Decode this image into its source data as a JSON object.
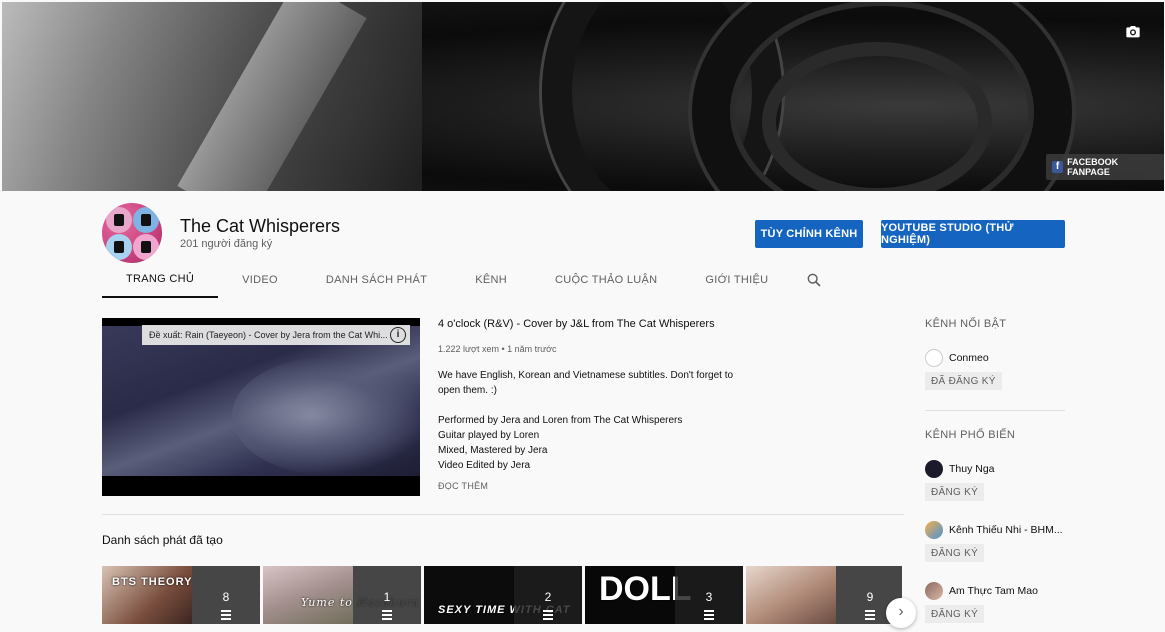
{
  "banner": {
    "facebook_link": "FACEBOOK FANPAGE",
    "camera_icon": "camera-icon"
  },
  "channel": {
    "name": "The Cat Whisperers",
    "subscribers": "201 người đăng ký",
    "customize_button": "TÙY CHỈNH KÊNH",
    "studio_button": "YOUTUBE STUDIO (THỬ NGHIỆM)",
    "accent_color": "#1565c0"
  },
  "tabs": [
    {
      "label": "TRANG CHỦ",
      "active": true
    },
    {
      "label": "VIDEO",
      "active": false
    },
    {
      "label": "DANH SÁCH PHÁT",
      "active": false
    },
    {
      "label": "KÊNH",
      "active": false
    },
    {
      "label": "CUỘC THẢO LUẬN",
      "active": false
    },
    {
      "label": "GIỚI THIỆU",
      "active": false
    }
  ],
  "featured_video": {
    "suggestion": "Đề xuất: Rain (Taeyeon) - Cover by Jera from the Cat Whi...",
    "title": "4 o'clock (R&V) - Cover by J&L from The Cat Whisperers",
    "meta": "1.222 lượt xem • 1 năm trước",
    "description_1": "We have English, Korean and Vietnamese subtitles. Don't forget to open them. :)",
    "description_2_line_1": "Performed by Jera and Loren from The Cat Whisperers",
    "description_2_line_2": "Guitar played by Loren",
    "description_2_line_3": "Mixed, Mastered by Jera",
    "description_2_line_4": "Video Edited by Jera",
    "read_more": "ĐỌC THÊM"
  },
  "playlists_section": {
    "title": "Danh sách phát đã tạo",
    "items": [
      {
        "caption": "BTS THEORY",
        "count": "8",
        "color": "#8a5a48"
      },
      {
        "caption": "Yume to Hazakura",
        "count": "1",
        "color": "#b8a7a3"
      },
      {
        "caption": "SEXY TIME WITH CAT",
        "count": "2",
        "color": "#111111"
      },
      {
        "caption": "DOLL",
        "count": "3",
        "color": "#0a0a0a"
      },
      {
        "caption": "",
        "count": "9",
        "color": "#c8b0a4"
      }
    ]
  },
  "sidebar": {
    "featured_title": "KÊNH NỔI BẬT",
    "featured": [
      {
        "name": "Conmeo",
        "button": "ĐÃ ĐĂNG KÝ"
      }
    ],
    "popular_title": "KÊNH PHỔ BIẾN",
    "popular": [
      {
        "name": "Thuy Nga",
        "button": "ĐĂNG KÝ"
      },
      {
        "name": "Kênh Thiếu Nhi - BHM...",
        "button": "ĐĂNG KÝ"
      },
      {
        "name": "Am Thực Tam Mao",
        "button": "ĐĂNG KÝ"
      }
    ]
  }
}
